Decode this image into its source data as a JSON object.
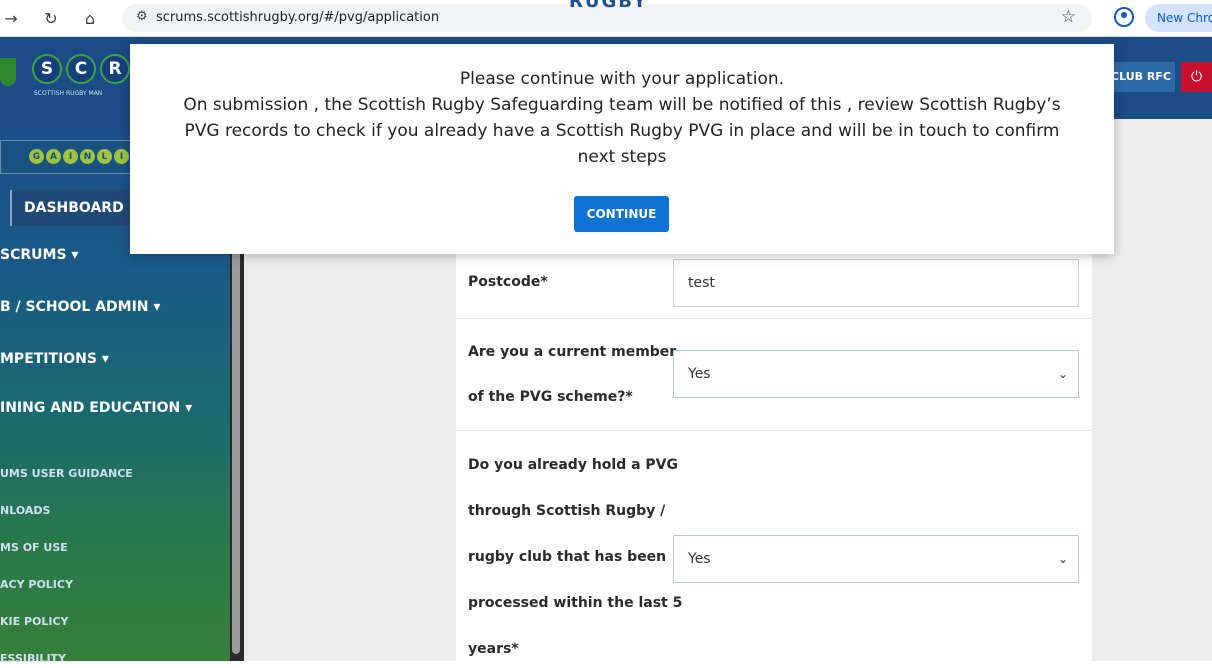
{
  "browser": {
    "url": "scrums.scottishrugby.org/#/pvg/application",
    "new_chrome_label": "New Chrome",
    "peek_text": "RUGBY"
  },
  "header": {
    "logo_letters": [
      "S",
      "C",
      "R"
    ],
    "logo_subtext": "SCOTTISH RUGBY MAN",
    "club_button": "CLUB RFC",
    "power_icon": "⏻"
  },
  "sidebar": {
    "gainline_letters": [
      "G",
      "A",
      "I",
      "N",
      "L",
      "I",
      "N"
    ],
    "dashboard": "DASHBOARD",
    "items": [
      "SCRUMS ▾",
      "B / SCHOOL ADMIN ▾",
      "MPETITIONS ▾",
      "INING AND EDUCATION ▾"
    ],
    "links": [
      "UMS USER GUIDANCE",
      "NLOADS",
      "MS OF USE",
      "ACY POLICY",
      "KIE POLICY",
      "ESSIBILITY"
    ]
  },
  "form": {
    "postcode_label": "Postcode*",
    "postcode_value": "test",
    "member_label_lines": [
      "Are you a current member",
      "of the PVG scheme?*"
    ],
    "member_value": "Yes",
    "hold_label_lines": [
      "Do you already hold a PVG",
      "through Scottish Rugby /",
      "rugby club that has been",
      "processed within the last 5",
      "years*"
    ],
    "hold_value": "Yes"
  },
  "modal": {
    "lines": [
      "Please continue with your application.",
      "On submission , the Scottish Rugby Safeguarding team will be notified of this , review Scottish Rugby’s",
      "PVG records to check if you already have a Scottish Rugby PVG in place and will be in touch to confirm",
      "next steps"
    ],
    "continue_label": "CONTINUE"
  },
  "icons": {
    "back": "arrow-right-icon",
    "reload": "reload-icon",
    "home": "home-icon",
    "site_settings": "site-settings-icon",
    "bookmark": "star-icon",
    "profile": "profile-icon"
  },
  "colors": {
    "header_blue": "#1c4c86",
    "continue_blue": "#0d74d4",
    "power_red": "#c8102e",
    "gainline_green": "#9fc53f"
  }
}
